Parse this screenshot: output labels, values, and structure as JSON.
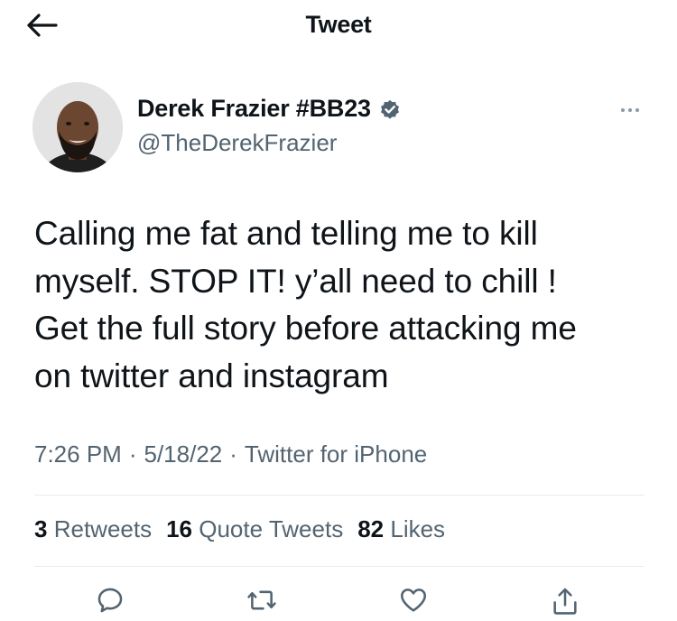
{
  "header": {
    "title": "Tweet",
    "back_icon": "arrow-left-icon"
  },
  "author": {
    "display_name": "Derek Frazier #BB23",
    "handle": "@TheDerekFrazier",
    "verified": true,
    "verified_icon": "verified-badge-icon",
    "more_icon": "more-horizontal-icon"
  },
  "tweet": {
    "text": "Calling me fat and telling me to kill\nmyself. STOP IT! y’all need to chill !\nGet the full story before attacking me\non twitter and instagram"
  },
  "meta": {
    "time": "7:26 PM",
    "date": "5/18/22",
    "source": "Twitter for iPhone",
    "separator": "·"
  },
  "stats": {
    "retweets_count": "3",
    "retweets_label": "Retweets",
    "quotes_count": "16",
    "quotes_label": "Quote Tweets",
    "likes_count": "82",
    "likes_label": "Likes"
  },
  "actions": [
    {
      "name": "reply",
      "icon": "reply-icon"
    },
    {
      "name": "retweet",
      "icon": "retweet-icon"
    },
    {
      "name": "like",
      "icon": "heart-icon"
    },
    {
      "name": "share",
      "icon": "share-icon"
    }
  ],
  "colors": {
    "text_primary": "#0f1419",
    "text_secondary": "#536471",
    "divider": "#e6ecf0",
    "verified_badge": "#536471"
  }
}
